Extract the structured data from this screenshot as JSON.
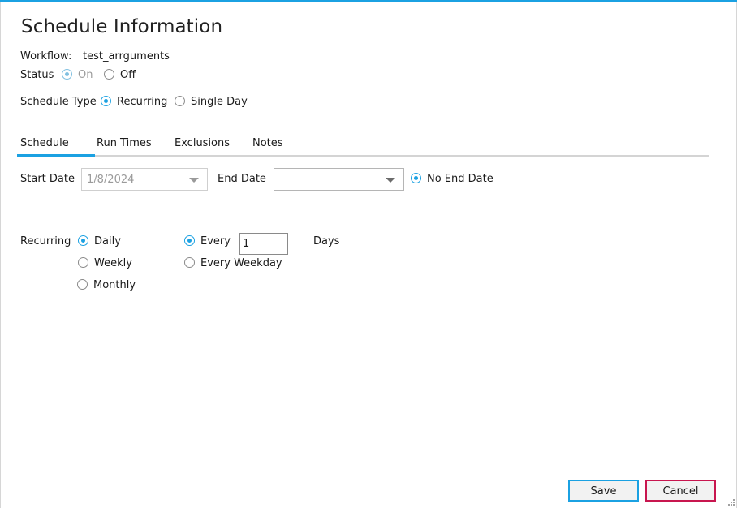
{
  "dialog": {
    "title": "Schedule Information"
  },
  "workflow": {
    "label": "Workflow:",
    "value": "test_arrguments"
  },
  "status": {
    "label": "Status",
    "options": [
      {
        "label": "On",
        "checked": true,
        "disabled": true
      },
      {
        "label": "Off",
        "checked": false,
        "disabled": false
      }
    ]
  },
  "schedule_type": {
    "label": "Schedule Type",
    "options": [
      {
        "label": "Recurring",
        "checked": true
      },
      {
        "label": "Single Day",
        "checked": false
      }
    ]
  },
  "tabs": [
    {
      "label": "Schedule",
      "active": true
    },
    {
      "label": "Run Times",
      "active": false
    },
    {
      "label": "Exclusions",
      "active": false
    },
    {
      "label": "Notes",
      "active": false
    }
  ],
  "dates": {
    "start_label": "Start Date",
    "start_value": "1/8/2024",
    "end_label": "End Date",
    "end_value": "",
    "no_end_label": "No End Date",
    "no_end_checked": true
  },
  "recurring": {
    "label": "Recurring",
    "frequency": [
      {
        "label": "Daily",
        "checked": true
      },
      {
        "label": "Weekly",
        "checked": false
      },
      {
        "label": "Monthly",
        "checked": false
      }
    ],
    "daily_options": [
      {
        "label": "Every",
        "checked": true
      },
      {
        "label": "Every Weekday",
        "checked": false
      }
    ],
    "every_value": "1",
    "unit_label": "Days"
  },
  "buttons": {
    "save": "Save",
    "cancel": "Cancel"
  },
  "colors": {
    "accent": "#1ba1e2",
    "cancel_border": "#c8164f"
  }
}
